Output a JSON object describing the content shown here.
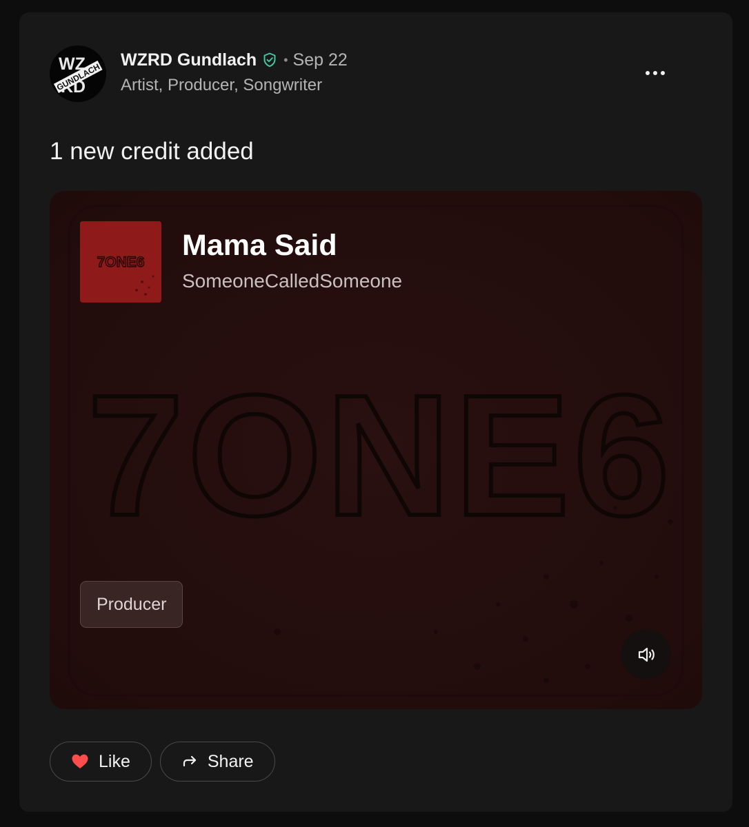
{
  "post": {
    "author": {
      "name": "WZRD Gundlach",
      "roles": "Artist, Producer, Songwriter",
      "verified": true,
      "avatar_text": [
        "WZ",
        "KD",
        "GUNDLACH"
      ]
    },
    "separator": "•",
    "date": "Sep 22",
    "text": "1 new credit added",
    "more_icon": "more-horizontal-icon"
  },
  "credit": {
    "title": "Mama Said",
    "artist": "SomeoneCalledSomeone",
    "cover_text": "7ONE6",
    "role": "Producer",
    "volume_icon": "volume-icon"
  },
  "actions": {
    "like_label": "Like",
    "share_label": "Share"
  },
  "colors": {
    "page_bg": "#0d0d0d",
    "card_bg": "#181818",
    "credit_bg": "#260e0e",
    "cover_red": "#8e1a1a",
    "heart": "#ff4d4d",
    "verified": "#3fc9a0"
  }
}
